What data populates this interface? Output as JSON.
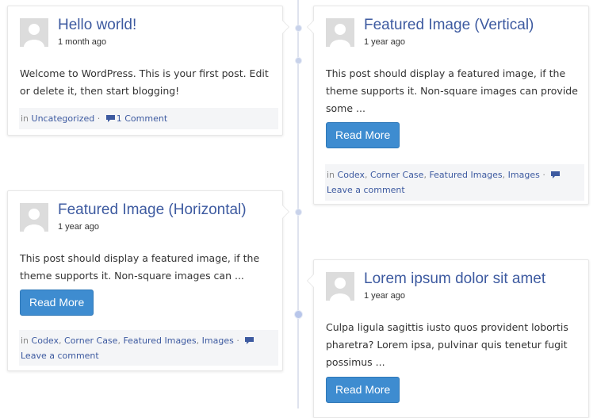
{
  "posts": [
    {
      "title": "Hello world!",
      "date": "1 month ago",
      "excerpt": "Welcome to WordPress. This is your first post. Edit or delete it, then start blogging!",
      "meta_prefix": "in",
      "categories": [
        "Uncategorized"
      ],
      "separator": "·",
      "comment_text": "1 Comment"
    },
    {
      "title": "Featured Image (Vertical)",
      "date": "1 year ago",
      "excerpt": "This post should display a featured image, if the theme supports it. Non-square images can provide some ...",
      "read_more": "Read More",
      "meta_prefix": "in",
      "categories": [
        "Codex",
        "Corner Case",
        "Featured Images",
        "Images"
      ],
      "separator": "·",
      "comment_text": "Leave a comment"
    },
    {
      "title": "Featured Image (Horizontal)",
      "date": "1 year ago",
      "excerpt": "This post should display a featured image, if the theme supports it. Non-square images can ...",
      "read_more": "Read More",
      "meta_prefix": "in",
      "categories": [
        "Codex",
        "Corner Case",
        "Featured Images",
        "Images"
      ],
      "separator": "·",
      "comment_text": "Leave a comment"
    },
    {
      "title": "Lorem ipsum dolor sit amet",
      "date": "1 year ago",
      "excerpt": "Culpa ligula sagittis iusto quos provident lobortis pharetra? Lorem ipsa, pulvinar quis tenetur fugit possimus ...",
      "read_more": "Read More"
    }
  ],
  "colors": {
    "link": "#3d5aa0",
    "button": "#3e8cd0",
    "meta_bg": "#f4f5f7",
    "timeline": "#dfe3ee"
  },
  "icons": {
    "avatar": "default-avatar-icon",
    "comment": "comment-bubble-icon"
  }
}
